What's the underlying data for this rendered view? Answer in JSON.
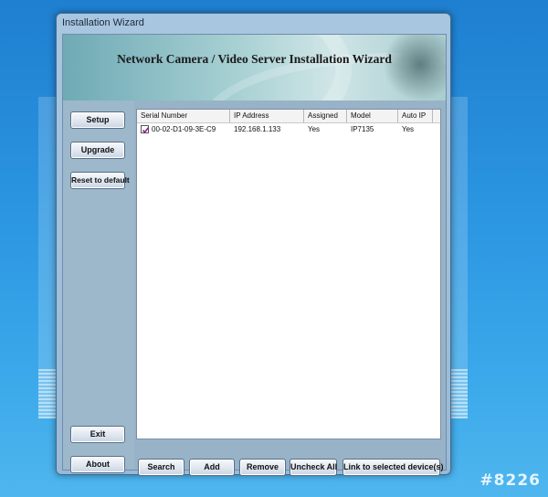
{
  "window": {
    "title": "Installation Wizard"
  },
  "banner": {
    "title": "Network Camera / Video Server Installation Wizard"
  },
  "sidebar": {
    "setup": "Setup",
    "upgrade": "Upgrade",
    "reset": "Reset to default",
    "exit": "Exit",
    "about": "About"
  },
  "table": {
    "columns": [
      "Serial Number",
      "IP Address",
      "Assigned",
      "Model",
      "Auto IP"
    ],
    "rows": [
      {
        "checked": true,
        "serial": "00-02-D1-09-3E-C9",
        "ip": "192.168.1.133",
        "assigned": "Yes",
        "model": "IP7135",
        "auto_ip": "Yes"
      }
    ]
  },
  "actions": {
    "search": "Search",
    "add": "Add",
    "remove": "Remove",
    "uncheck_all": "Uncheck All",
    "link": "Link to selected device(s)"
  },
  "watermark": "#8226"
}
